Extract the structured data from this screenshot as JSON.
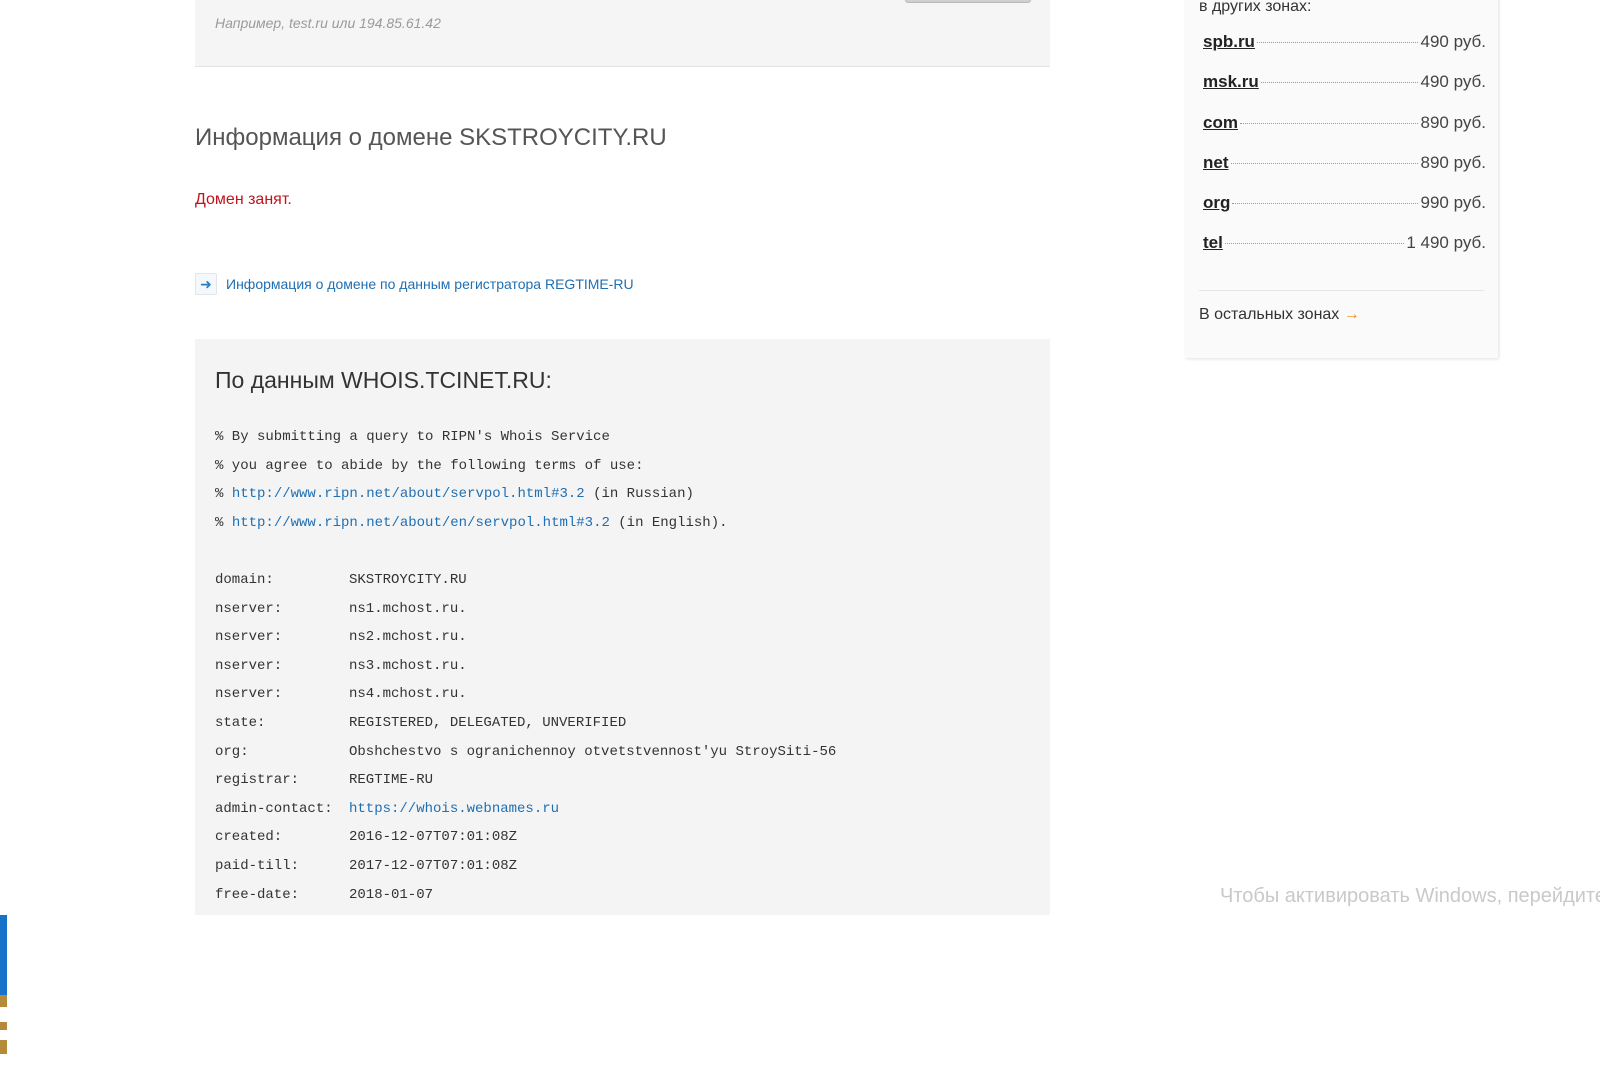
{
  "search": {
    "hint": "Например, test.ru или 194.85.61.42"
  },
  "domain_info": {
    "title": "Информация о домене SKSTROYCITY.RU",
    "status": "Домен занят.",
    "registrar_link": "Информация о домене по данным регистратора REGTIME-RU"
  },
  "whois": {
    "title": "По данным WHOIS.TCINET.RU:",
    "header_lines": [
      "% By submitting a query to RIPN's Whois Service",
      "% you agree to abide by the following terms of use:"
    ],
    "link_lines": [
      {
        "prefix": "% ",
        "url": "http://www.ripn.net/about/servpol.html#3.2",
        "suffix": " (in Russian)"
      },
      {
        "prefix": "% ",
        "url": "http://www.ripn.net/about/en/servpol.html#3.2",
        "suffix": " (in English)."
      }
    ],
    "records": [
      {
        "key": "domain:",
        "value": "SKSTROYCITY.RU"
      },
      {
        "key": "nserver:",
        "value": "ns1.mchost.ru."
      },
      {
        "key": "nserver:",
        "value": "ns2.mchost.ru."
      },
      {
        "key": "nserver:",
        "value": "ns3.mchost.ru."
      },
      {
        "key": "nserver:",
        "value": "ns4.mchost.ru."
      },
      {
        "key": "state:",
        "value": "REGISTERED, DELEGATED, UNVERIFIED"
      },
      {
        "key": "org:",
        "value": "Obshchestvo s ogranichennoy otvetstvennost'yu StroySiti-56"
      },
      {
        "key": "registrar:",
        "value": "REGTIME-RU"
      },
      {
        "key": "admin-contact:",
        "value": "https://whois.webnames.ru",
        "link": true
      },
      {
        "key": "created:",
        "value": "2016-12-07T07:01:08Z"
      },
      {
        "key": "paid-till:",
        "value": "2017-12-07T07:01:08Z"
      },
      {
        "key": "free-date:",
        "value": "2018-01-07"
      }
    ]
  },
  "sidebar": {
    "heading": "в других зонах:",
    "zones": [
      {
        "name": "spb.ru",
        "price": "490 руб."
      },
      {
        "name": "msk.ru",
        "price": "490 руб."
      },
      {
        "name": "com",
        "price": "890 руб."
      },
      {
        "name": "net",
        "price": "890 руб."
      },
      {
        "name": "org",
        "price": "990 руб."
      },
      {
        "name": "tel",
        "price": "1 490 руб."
      }
    ],
    "other_zones": "В остальных зонах",
    "other_zones_arrow": "→"
  },
  "watermark": "Чтобы активировать Windows, перейдите к",
  "colors": {
    "link": "#1f6fb2",
    "status_red": "#c0131a",
    "accent_orange": "#f08a16"
  }
}
